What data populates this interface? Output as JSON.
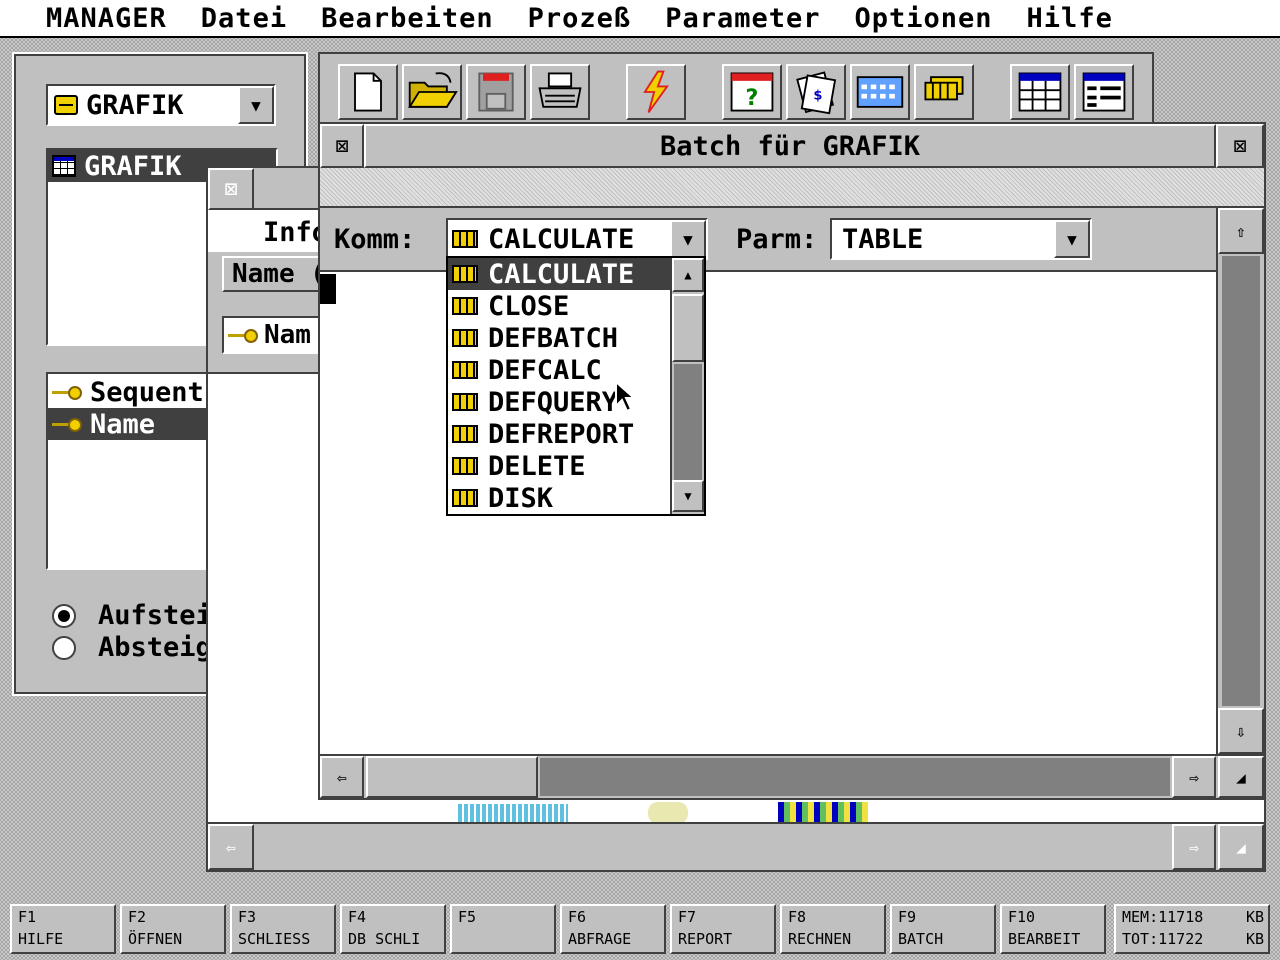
{
  "menubar": [
    "MANAGER",
    "Datei",
    "Bearbeiten",
    "Prozeß",
    "Parameter",
    "Optionen",
    "Hilfe"
  ],
  "left_panel": {
    "db_select": "GRAFIK",
    "tables": [
      "GRAFIK"
    ],
    "indexes": [
      "Sequent:",
      "Name"
    ],
    "sort_options": [
      "Aufstei",
      "Absteig"
    ]
  },
  "info_window": {
    "title": "Info",
    "field_label": "Name (",
    "key_field": "Nam"
  },
  "toolbar": [
    "new-document-icon",
    "open-folder-icon",
    "save-disk-icon",
    "print-icon",
    "lightning-icon",
    "help-table-icon",
    "report-icon",
    "calculator-icon",
    "batch-icon",
    "table-view-icon",
    "form-view-icon"
  ],
  "batch_window": {
    "title": "Batch für GRAFIK",
    "komm_label": "Komm:",
    "komm_value": "CALCULATE",
    "parm_label": "Parm:",
    "parm_value": "TABLE",
    "commands": [
      "CALCULATE",
      "CLOSE",
      "DEFBATCH",
      "DEFCALC",
      "DEFQUERY",
      "DEFREPORT",
      "DELETE",
      "DISK"
    ],
    "selected_command": "CALCULATE"
  },
  "fkeys": [
    {
      "key": "F1",
      "label": "HILFE"
    },
    {
      "key": "F2",
      "label": "ÖFFNEN"
    },
    {
      "key": "F3",
      "label": "SCHLIESS"
    },
    {
      "key": "F4",
      "label": "DB SCHLI"
    },
    {
      "key": "F5",
      "label": ""
    },
    {
      "key": "F6",
      "label": "ABFRAGE"
    },
    {
      "key": "F7",
      "label": "REPORT"
    },
    {
      "key": "F8",
      "label": "RECHNEN"
    },
    {
      "key": "F9",
      "label": "BATCH"
    },
    {
      "key": "F10",
      "label": "BEARBEIT"
    }
  ],
  "memory": {
    "mem_label": "MEM:",
    "mem_value": "11718",
    "tot_label": "TOT:",
    "tot_value": "11722",
    "unit": "KB"
  },
  "colors": {
    "face": "#c0c0c0",
    "selection": "#404040",
    "icon_yellow": "#f0d000",
    "title_blue": "#0000c0"
  }
}
